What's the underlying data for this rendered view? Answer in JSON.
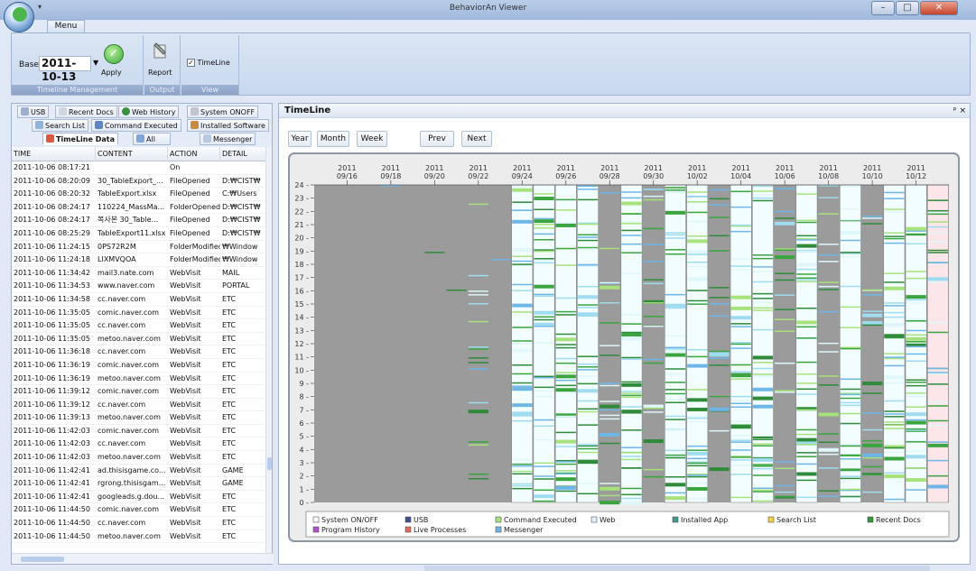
{
  "window": {
    "title": "BehaviorAn Viewer"
  },
  "menu": {
    "tab_label": "Menu"
  },
  "ribbon": {
    "base_label": "Base",
    "base_date": "2011-10-13",
    "apply_label": "Apply",
    "report_label": "Report",
    "timeline_label": "TimeLine",
    "timeline_checked": true,
    "groups": [
      "Timeline Management",
      "Output",
      "View"
    ]
  },
  "left_tabs": {
    "row1": [
      "USB",
      "Recent Docs",
      "Web History",
      "System ONOFF"
    ],
    "row2": [
      "Search List",
      "Command Executed",
      "Installed Software"
    ],
    "row3": [
      "TimeLine Data",
      "All",
      "Messenger"
    ]
  },
  "grid": {
    "columns": [
      "TIME",
      "CONTENT",
      "ACTION",
      "DETAIL"
    ],
    "rows": [
      [
        "2011-10-06 08:17:21",
        "",
        "On",
        ""
      ],
      [
        "2011-10-06 08:20:09",
        "30_TableExport_...",
        "FileOpened",
        "D:₩CIST₩"
      ],
      [
        "2011-10-06 08:20:32",
        "TableExport.xlsx",
        "FileOpened",
        "C:₩Users"
      ],
      [
        "2011-10-06 08:24:17",
        "110224_MassMa...",
        "FolderOpened",
        "D:₩CIST₩"
      ],
      [
        "2011-10-06 08:24:17",
        "복사본 30_Table...",
        "FileOpened",
        "D:₩CIST₩"
      ],
      [
        "2011-10-06 08:25:29",
        "TableExport11.xlsx",
        "FileOpened",
        "D:₩CIST₩"
      ],
      [
        "2011-10-06 11:24:15",
        "0PS72R2M",
        "FolderModified",
        "₩Window"
      ],
      [
        "2011-10-06 11:24:18",
        "LIXMVQOA",
        "FolderModified",
        "₩Window"
      ],
      [
        "2011-10-06 11:34:42",
        "mail3.nate.com",
        "WebVisit",
        "MAIL"
      ],
      [
        "2011-10-06 11:34:53",
        "www.naver.com",
        "WebVisit",
        "PORTAL"
      ],
      [
        "2011-10-06 11:34:58",
        "cc.naver.com",
        "WebVisit",
        "ETC"
      ],
      [
        "2011-10-06 11:35:05",
        "comic.naver.com",
        "WebVisit",
        "ETC"
      ],
      [
        "2011-10-06 11:35:05",
        "cc.naver.com",
        "WebVisit",
        "ETC"
      ],
      [
        "2011-10-06 11:35:05",
        "metoo.naver.com",
        "WebVisit",
        "ETC"
      ],
      [
        "2011-10-06 11:36:18",
        "cc.naver.com",
        "WebVisit",
        "ETC"
      ],
      [
        "2011-10-06 11:36:19",
        "comic.naver.com",
        "WebVisit",
        "ETC"
      ],
      [
        "2011-10-06 11:36:19",
        "metoo.naver.com",
        "WebVisit",
        "ETC"
      ],
      [
        "2011-10-06 11:39:12",
        "comic.naver.com",
        "WebVisit",
        "ETC"
      ],
      [
        "2011-10-06 11:39:12",
        "cc.naver.com",
        "WebVisit",
        "ETC"
      ],
      [
        "2011-10-06 11:39:13",
        "metoo.naver.com",
        "WebVisit",
        "ETC"
      ],
      [
        "2011-10-06 11:42:03",
        "comic.naver.com",
        "WebVisit",
        "ETC"
      ],
      [
        "2011-10-06 11:42:03",
        "cc.naver.com",
        "WebVisit",
        "ETC"
      ],
      [
        "2011-10-06 11:42:03",
        "metoo.naver.com",
        "WebVisit",
        "ETC"
      ],
      [
        "2011-10-06 11:42:41",
        "ad.thisisgame.co...",
        "WebVisit",
        "GAME"
      ],
      [
        "2011-10-06 11:42:41",
        "rgrong.thisisgam...",
        "WebVisit",
        "GAME"
      ],
      [
        "2011-10-06 11:42:41",
        "googleads.g.dou...",
        "WebVisit",
        "ETC"
      ],
      [
        "2011-10-06 11:44:50",
        "comic.naver.com",
        "WebVisit",
        "ETC"
      ],
      [
        "2011-10-06 11:44:50",
        "cc.naver.com",
        "WebVisit",
        "ETC"
      ],
      [
        "2011-10-06 11:44:50",
        "metoo.naver.com",
        "WebVisit",
        "ETC"
      ]
    ]
  },
  "timeline": {
    "title": "TimeLine",
    "pin_label": "ᵖ ×",
    "buttons": [
      "Year",
      "Month",
      "Week",
      "Prev",
      "Next"
    ]
  },
  "chart_data": {
    "type": "heatmap",
    "x_year": "2011",
    "x_labels": [
      "09/16",
      "09/18",
      "09/20",
      "09/22",
      "09/24",
      "09/26",
      "09/28",
      "09/30",
      "10/02",
      "10/04",
      "10/06",
      "10/08",
      "10/10",
      "10/12"
    ],
    "y_ticks": [
      24,
      23,
      22,
      21,
      20,
      19,
      18,
      17,
      16,
      15,
      14,
      13,
      12,
      11,
      10,
      9,
      8,
      7,
      6,
      5,
      4,
      3,
      2,
      1,
      0
    ],
    "ylim": [
      0,
      24
    ],
    "days": [
      "09/15",
      "09/16",
      "09/17",
      "09/18",
      "09/19",
      "09/20",
      "09/21",
      "09/22",
      "09/23",
      "09/24",
      "09/25",
      "09/26",
      "09/27",
      "09/28",
      "09/29",
      "09/30",
      "10/01",
      "10/02",
      "10/03",
      "10/04",
      "10/05",
      "10/06",
      "10/07",
      "10/08",
      "10/09",
      "10/10",
      "10/11",
      "10/12",
      "10/13"
    ],
    "day_backgrounds": [
      "gray",
      "gray",
      "gray",
      "gray",
      "gray",
      "gray",
      "gray",
      "gray",
      "gray",
      "white",
      "white",
      "white",
      "white",
      "gray",
      "white",
      "gray",
      "white",
      "white",
      "gray",
      "white",
      "white",
      "gray",
      "white",
      "gray",
      "white",
      "gray",
      "white",
      "white",
      "pink"
    ],
    "legend": [
      {
        "name": "System ON/OFF",
        "color": "#ffffff"
      },
      {
        "name": "USB",
        "color": "#3a4f8e"
      },
      {
        "name": "Command Executed",
        "color": "#a7e27c"
      },
      {
        "name": "Web",
        "color": "#dff6fb"
      },
      {
        "name": "Installed App",
        "color": "#3e9a96"
      },
      {
        "name": "Search List",
        "color": "#f0d23c"
      },
      {
        "name": "Recent Docs",
        "color": "#2f9a35"
      },
      {
        "name": "Program History",
        "color": "#b04fc9"
      },
      {
        "name": "Live Processes",
        "color": "#e26a5a"
      },
      {
        "name": "Messenger",
        "color": "#6fb6e8"
      }
    ]
  }
}
